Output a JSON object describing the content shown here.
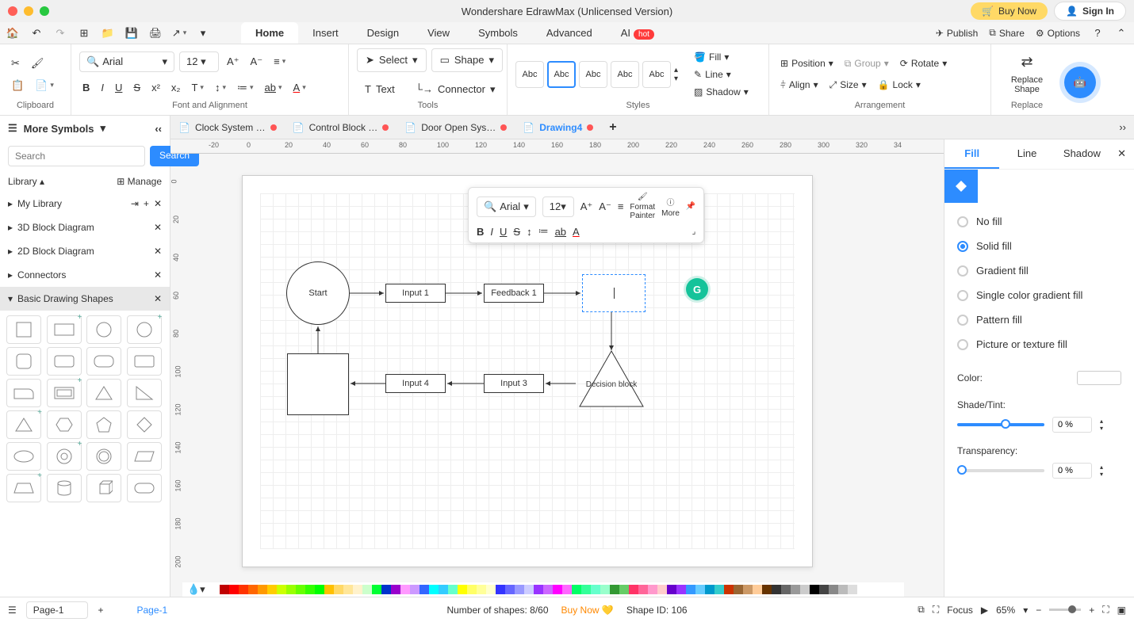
{
  "app_title": "Wondershare EdrawMax (Unlicensed Version)",
  "buy_now": "Buy Now",
  "sign_in": "Sign In",
  "menu_tabs": [
    "Home",
    "Insert",
    "Design",
    "View",
    "Symbols",
    "Advanced",
    "AI"
  ],
  "menu_active": "Home",
  "ai_badge": "hot",
  "menu_right": {
    "publish": "Publish",
    "share": "Share",
    "options": "Options"
  },
  "ribbon": {
    "clipboard_label": "Clipboard",
    "font_label": "Font and Alignment",
    "tools_label": "Tools",
    "styles_label": "Styles",
    "arrangement_label": "Arrangement",
    "replace_label": "Replace",
    "font_name": "Arial",
    "font_size": "12",
    "select": "Select",
    "text": "Text",
    "shape": "Shape",
    "connector": "Connector",
    "style_abc": "Abc",
    "fill": "Fill",
    "line": "Line",
    "shadow": "Shadow",
    "position": "Position",
    "group": "Group",
    "rotate": "Rotate",
    "align": "Align",
    "size": "Size",
    "lock": "Lock",
    "replace_shape": "Replace\nShape"
  },
  "doc_tabs": [
    {
      "name": "Clock System …",
      "unsaved": true,
      "active": false
    },
    {
      "name": "Control Block …",
      "unsaved": true,
      "active": false
    },
    {
      "name": "Door Open Sys…",
      "unsaved": true,
      "active": false
    },
    {
      "name": "Drawing4",
      "unsaved": true,
      "active": true
    }
  ],
  "ruler_h": [
    "-20",
    "0",
    "20",
    "40",
    "60",
    "80",
    "100",
    "120",
    "140",
    "160",
    "180",
    "200",
    "220",
    "240",
    "260",
    "280",
    "300",
    "320",
    "34"
  ],
  "ruler_v": [
    "0",
    "20",
    "40",
    "60",
    "80",
    "100",
    "120",
    "140",
    "160",
    "180",
    "200"
  ],
  "left": {
    "more_symbols": "More Symbols",
    "search_placeholder": "Search",
    "search_btn": "Search",
    "library": "Library",
    "manage": "Manage",
    "my_library": "My Library",
    "categories": [
      "3D Block Diagram",
      "2D Block Diagram",
      "Connectors",
      "Basic Drawing Shapes"
    ]
  },
  "flowchart": {
    "start": "Start",
    "input1": "Input 1",
    "feedback1": "Feedback 1",
    "input4": "Input 4",
    "input3": "Input 3",
    "decision": "Decision block"
  },
  "float": {
    "font": "Arial",
    "size": "12",
    "format_painter": "Format\nPainter",
    "more": "More"
  },
  "right": {
    "tabs": [
      "Fill",
      "Line",
      "Shadow"
    ],
    "active": "Fill",
    "no_fill": "No fill",
    "solid_fill": "Solid fill",
    "gradient_fill": "Gradient fill",
    "single_gradient": "Single color gradient fill",
    "pattern_fill": "Pattern fill",
    "picture_fill": "Picture or texture fill",
    "color": "Color:",
    "shade": "Shade/Tint:",
    "shade_val": "0 %",
    "transparency": "Transparency:",
    "trans_val": "0 %"
  },
  "status": {
    "page": "Page-1",
    "page_tab": "Page-1",
    "shapes": "Number of shapes: 8/60",
    "buy": "Buy Now",
    "shape_id": "Shape ID: 106",
    "focus": "Focus",
    "zoom": "65%"
  },
  "palette_colors": [
    "#ffffff",
    "#c00000",
    "#ff0000",
    "#ff3300",
    "#ff6600",
    "#ff9900",
    "#ffcc00",
    "#ccff00",
    "#99ff00",
    "#66ff00",
    "#33ff00",
    "#00ff00",
    "#ffc000",
    "#ffd966",
    "#ffe699",
    "#fff2cc",
    "#ccffcc",
    "#00ff33",
    "#0033cc",
    "#9900cc",
    "#ff99ff",
    "#cc99ff",
    "#3366ff",
    "#00ffff",
    "#33ccff",
    "#66ffcc",
    "#ffff00",
    "#ffff66",
    "#ffff99",
    "#ffffcc",
    "#3333ff",
    "#6666ff",
    "#9999ff",
    "#ccccff",
    "#9933ff",
    "#cc66ff",
    "#ff00ff",
    "#ff66ff",
    "#00ff66",
    "#33ff99",
    "#66ffcc",
    "#99ffcc",
    "#339933",
    "#66cc66",
    "#ff3366",
    "#ff6699",
    "#ff99cc",
    "#ffcccc",
    "#6600cc",
    "#9933ff",
    "#3399ff",
    "#66ccff",
    "#0099cc",
    "#33cccc",
    "#cc3300",
    "#996633",
    "#cc9966",
    "#ffcc99",
    "#663300",
    "#333333",
    "#666666",
    "#999999",
    "#cccccc",
    "#000000",
    "#444444",
    "#888888",
    "#bbbbbb",
    "#dddddd"
  ]
}
